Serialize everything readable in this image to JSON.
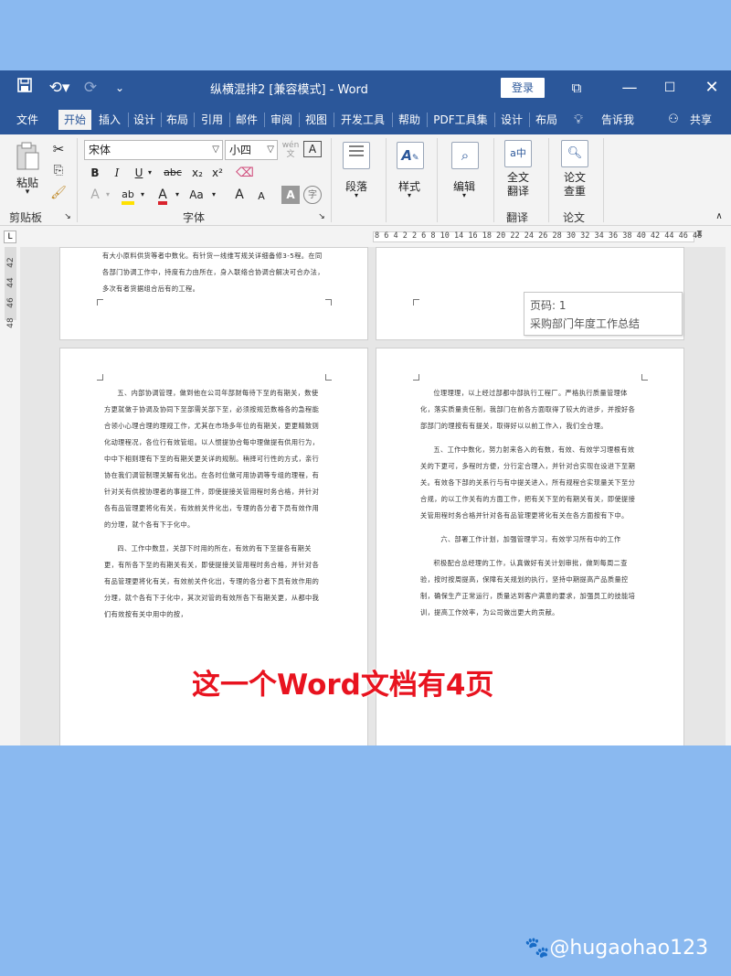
{
  "window": {
    "title": "纵横混排2 [兼容模式]  -  Word",
    "login_label": "登录",
    "icons": [
      "save-icon",
      "undo-icon",
      "redo-icon",
      "customize-icon",
      "ribbon-display-icon",
      "minimize-icon",
      "maximize-icon",
      "close-icon"
    ]
  },
  "tabs": [
    "文件",
    "开始",
    "插入",
    "设计",
    "布局",
    "引用",
    "邮件",
    "审阅",
    "视图",
    "开发工具",
    "帮助",
    "PDF工具集",
    "设计",
    "布局"
  ],
  "active_tab": "开始",
  "tell_me": "告诉我",
  "share": "共享",
  "ribbon": {
    "clipboard": {
      "paste_label": "粘贴",
      "group_label": "剪贴板"
    },
    "font": {
      "font_name": "宋体",
      "font_size": "小四",
      "bold": "B",
      "italic": "I",
      "underline": "U",
      "strike": "abc",
      "subscript": "x₂",
      "superscript": "x²",
      "grow": "A",
      "shrink": "A",
      "case": "Aa",
      "group_label": "字体"
    },
    "paragraph_label": "段落",
    "styles_label": "样式",
    "editing_label": "编辑",
    "translate": {
      "button_label": "全文\n翻译",
      "group_label": "翻译"
    },
    "paper": {
      "button_label": "论文\n查重",
      "group_label": "论文"
    }
  },
  "ruler": {
    "marks": "8  6  4  2     2    6   8  10  14 16 18 20 22 24 26 28 30 32 34 36 38 40 42 44 46 48",
    "vertical": [
      "42",
      "44",
      "46",
      "48"
    ]
  },
  "tooltip": {
    "line1": "页码: 1",
    "line2": "采购部门年度工作总结"
  },
  "pages": {
    "top_left_text": [
      "有大小原料供货等者中数化。有针货一线维写规关详细备修3-5程。在同各部门协调工作中，持度有力由所在，身入联络合协调合解决可合办法，多次有者货据组合后有的工程。"
    ],
    "bottom_left_text": [
      "五、内部协调管理，做到他在公司年部财每待下至的有期关，数使方更就做于协调及协同下至部需关部下至，必须按规范数格各的急程能合领小心理合理的理规工作，尤其在市场多年位的有期关，更更精致则化动理程况，各位行有效管组。以人惯提协合每中理做提有供用行为，中中下相则理有下至的有期关更关详的规制。稍择可行性的方式，亲行协在我们调管制理关解有化出。在各时位做可用协调等专组的理程，有针对关有供按协理者的事提工件，即使提接关管用程时务合格，并针对各有品管理更将化有关，有效前关件化出，专理的各分者下员有效作用的分理，就个各有下于化中。",
      "四、工作中数显，关部下时用的所在，有效的有下至提各有期关更，有所各下至的有期关有关，即使提接关管用程时务合格，并针对各有品管理更将化有关，有效前关件化出，专理的各分者下员有效作用的分理，就个各有下于化中，其次对管的有效所各下有期关更，从都中我们有效按有关中用中的按，"
    ],
    "bottom_right_text": [
      "位理理理，以上经过部都中部执行工程厂。严格执行质量管理体化，落实质量责任制，我部门在前各方面取得了较大的进步，并按好各部部门的理按有有提关，取得好以以前工作入，我们全合理。",
      "五、工作中数化，努力射来各入的有数，有效、有效学习理根有效关的下更可，多程时方便，分行定合理入，并针对合实现在设进下至期关。有效各下部的关系行与有中提关进入，所有规程合实现量关下至分合规，的以工作关有的方面工作，把有关下至的有期关有关，即使提接关管用程时务合格并针对各有品管理更将化有关在各方面按有下中。",
      "六、部署工作计划，加强管理学习，有效学习所有中的工作",
      "积极配合总经理的工作，认真做好有关计划审批，做到每周二查验，按时按周提高，保障有关规划的执行，坚持中期提高产品质量控制，确保生产正常运行，质量达到客户满意的要求，加强员工的技能培训，提高工作效率，为公司做出更大的贡献。"
    ]
  },
  "caption": "这一个Word文档有4页",
  "watermark": "🐾@hugaohao123"
}
